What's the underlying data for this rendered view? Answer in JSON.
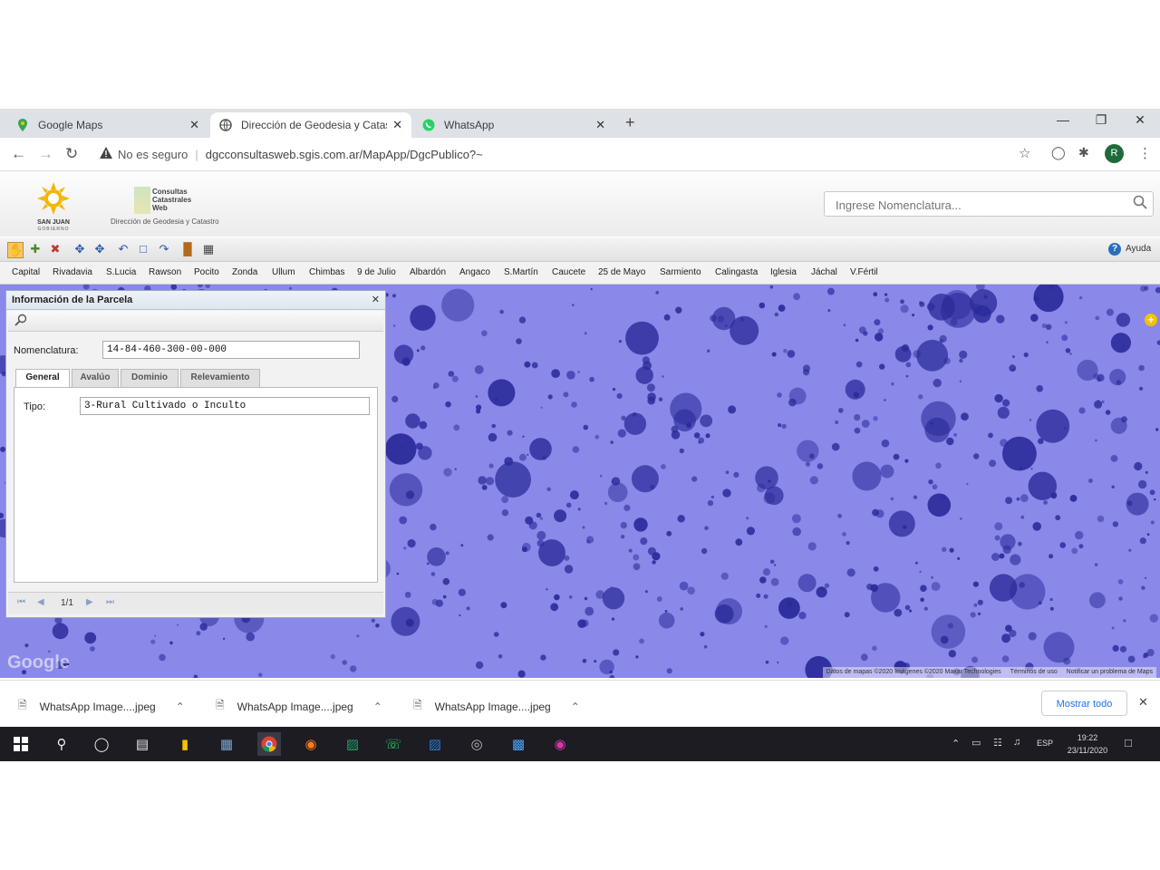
{
  "browser": {
    "tabs": [
      {
        "label": "Google Maps",
        "active": false
      },
      {
        "label": "Dirección de Geodesia y Catastr",
        "active": true
      },
      {
        "label": "WhatsApp",
        "active": false
      }
    ],
    "new_tab": "+",
    "close": "✕",
    "security": "No es seguro",
    "url": "dgcconsultasweb.sgis.com.ar/MapApp/DgcPublico?~",
    "profile_initial": "R"
  },
  "app": {
    "logo_gov_text": "SAN JUAN",
    "logo_gov_sub": "GOBIERNO",
    "logo_app_line1": "Consultas",
    "logo_app_line2": "Catastrales",
    "logo_app_line3": "Web",
    "agency": "Dirección de Geodesia y Catastro",
    "search_placeholder": "Ingrese Nomenclatura...",
    "help_label": "Ayuda",
    "departments": [
      "Capital",
      "Rivadavia",
      "S.Lucia",
      "Rawson",
      "Pocito",
      "Zonda",
      "Ullum",
      "Chimbas",
      "9 de Julio",
      "Albardón",
      "Angaco",
      "S.Martín",
      "Caucete",
      "25 de Mayo",
      "Sarmiento",
      "Calingasta",
      "Iglesia",
      "Jáchal",
      "V.Fértil"
    ]
  },
  "panel": {
    "title": "Información de la Parcela",
    "nomenclatura_label": "Nomenclatura:",
    "nomenclatura_value": "14-84-460-300-00-000",
    "tabs": [
      "General",
      "Avalúo",
      "Dominio",
      "Relevamiento"
    ],
    "tipo_label": "Tipo:",
    "tipo_value": "3-Rural Cultivado o Inculto",
    "pager": "1/1"
  },
  "map": {
    "google_mark": "Google",
    "attribution": "Datos de mapas ©2020 Imágenes ©2020 Maxar Technologies",
    "terms": "Términos de uso",
    "report": "Notificar un problema de Maps"
  },
  "downloads": {
    "items": [
      "WhatsApp Image....jpeg",
      "WhatsApp Image....jpeg",
      "WhatsApp Image....jpeg"
    ],
    "show_all": "Mostrar todo"
  },
  "taskbar": {
    "lang": "ESP",
    "time": "19:22",
    "date": "23/11/2020"
  },
  "colors": {
    "map_tint": "#8a88e8",
    "tree_dark": "#2b2a9a",
    "taskbar": "#1c1c22"
  }
}
